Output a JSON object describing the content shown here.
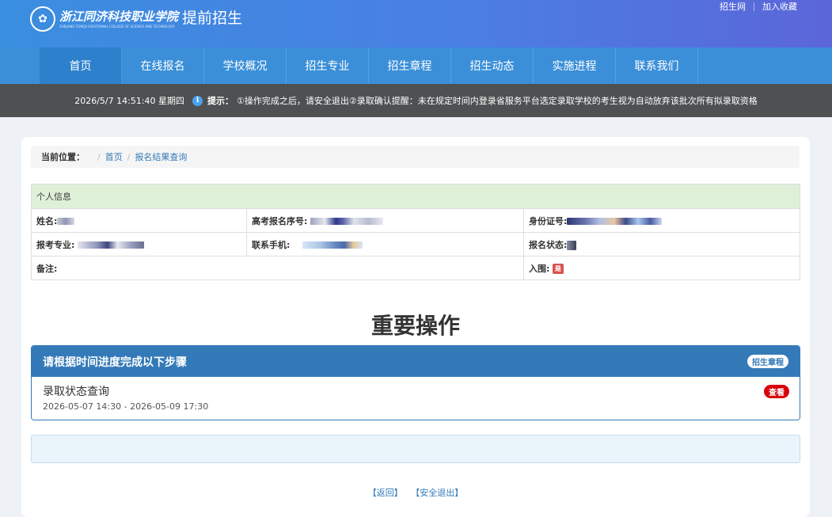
{
  "header": {
    "logo_cn": "浙江同济科技职业学院",
    "logo_en": "ZHEJIANG TONGJI VOCATIONAL COLLEGE OF SCIENCE AND TECHNOLOGY",
    "site_name": "提前招生",
    "links": [
      "招生网",
      "加入收藏"
    ]
  },
  "nav": {
    "items": [
      "首页",
      "在线报名",
      "学校概况",
      "招生专业",
      "招生章程",
      "招生动态",
      "实施进程",
      "联系我们"
    ],
    "active_index": 0
  },
  "notice": {
    "datetime": "2026/5/7 14:51:40 星期四",
    "hint_label": "提示：",
    "text": "①操作完成之后，请安全退出②录取确认提醒：未在规定时间内登录省服务平台选定录取学校的考生视为自动放弃该批次所有拟录取资格"
  },
  "breadcrumb": {
    "label": "当前位置：",
    "items": [
      "首页",
      "报名结果查询"
    ]
  },
  "personal_info": {
    "title": "个人信息",
    "name_label": "姓名:",
    "exam_no_label": "高考报名序号:",
    "id_label": "身份证号:",
    "major_label": "报考专业:",
    "phone_label": "联系手机:",
    "status_label": "报名状态:",
    "remark_label": "备注:",
    "shortlist_label": "入围:",
    "shortlist_value": "是"
  },
  "section_title": "重要操作",
  "steps": {
    "header": "请根据时间进度完成以下步骤",
    "header_badge": "招生章程",
    "items": [
      {
        "title": "录取状态查询",
        "time": "2026-05-07 14:30 - 2026-05-09 17:30",
        "action": "查看"
      }
    ]
  },
  "footer": {
    "back": "【返回】",
    "logout": "【安全退出】"
  },
  "colors": {
    "header_start": "#3a8ee0",
    "header_end": "#5b66d9",
    "nav": "#3a8fd8",
    "notice_bg": "#4e5052",
    "panel_head": "#347ab8",
    "badge_red": "#d9000b"
  }
}
